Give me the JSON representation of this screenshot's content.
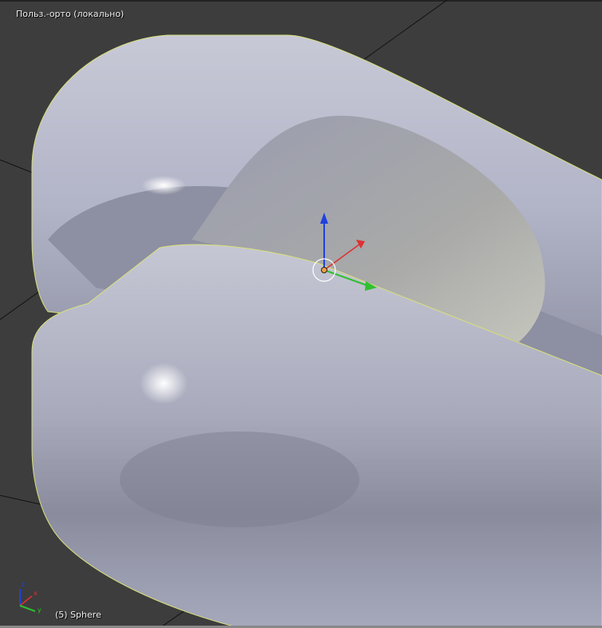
{
  "viewport": {
    "view_label": "Польз.-орто (локально)",
    "object_label": "(5) Sphere"
  },
  "axes_gizmo": {
    "x": "x",
    "y": "y",
    "z": "z"
  },
  "colors": {
    "background": "#3d3d3d",
    "mesh": "#b4b6c8",
    "outline": "#d8e07a",
    "x_axis": "#e03030",
    "y_axis": "#30c030",
    "z_axis": "#2040e0"
  }
}
